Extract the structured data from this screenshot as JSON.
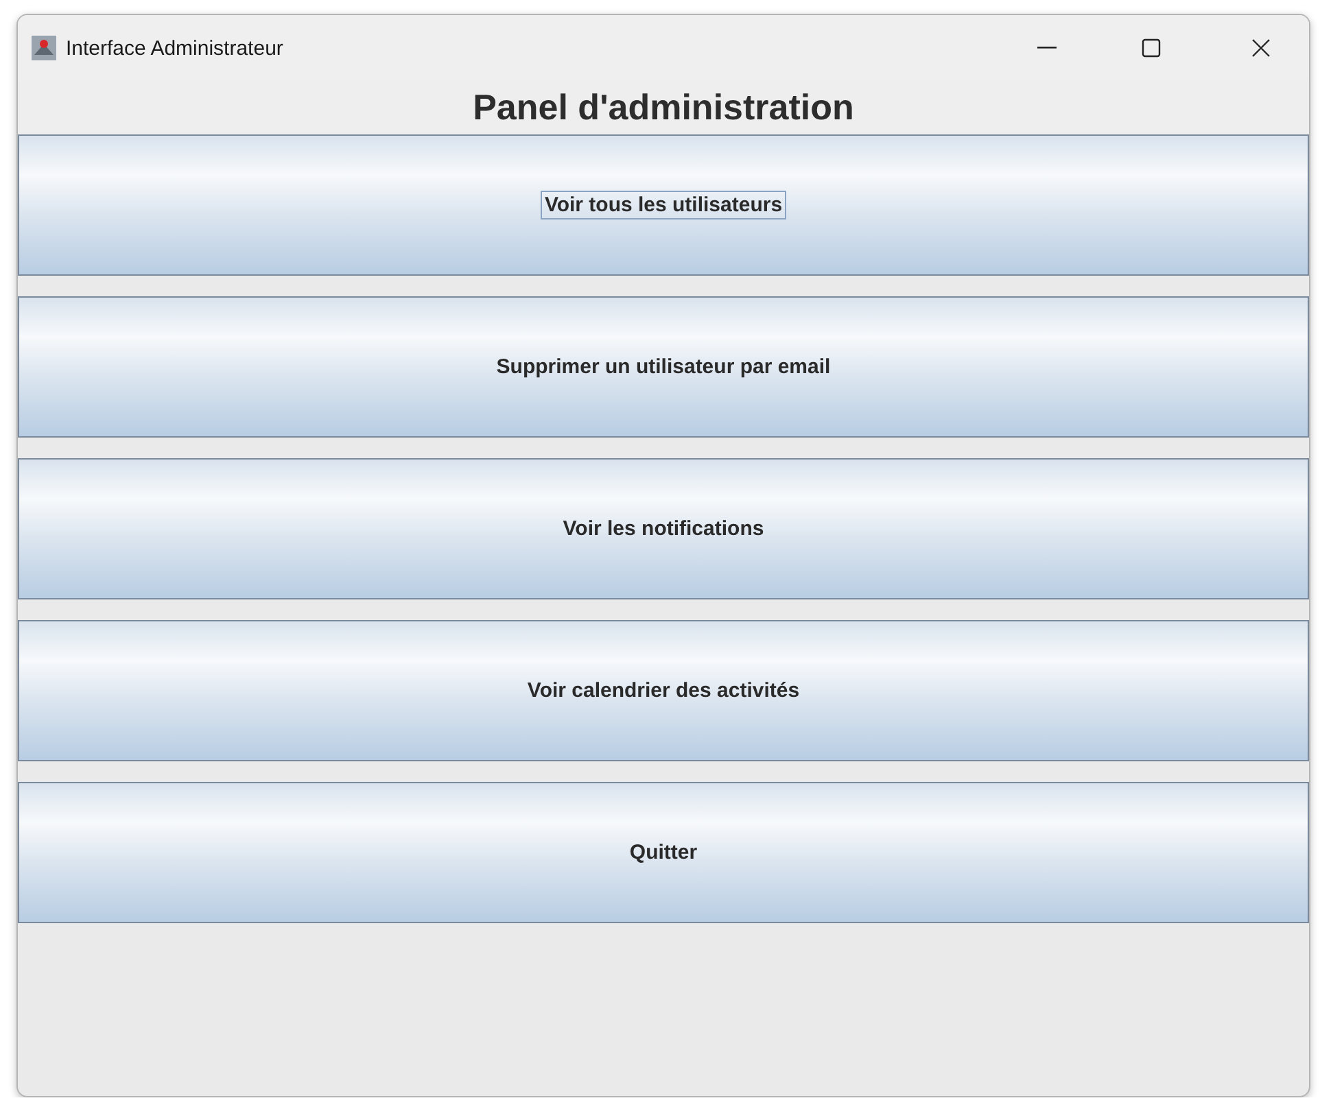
{
  "window": {
    "title": "Interface Administrateur"
  },
  "heading": "Panel d'administration",
  "buttons": [
    {
      "label": "Voir tous les utilisateurs",
      "focused": true
    },
    {
      "label": "Supprimer un utilisateur par email",
      "focused": false
    },
    {
      "label": "Voir les notifications",
      "focused": false
    },
    {
      "label": "Voir calendrier des activités",
      "focused": false
    },
    {
      "label": "Quitter",
      "focused": false
    }
  ]
}
